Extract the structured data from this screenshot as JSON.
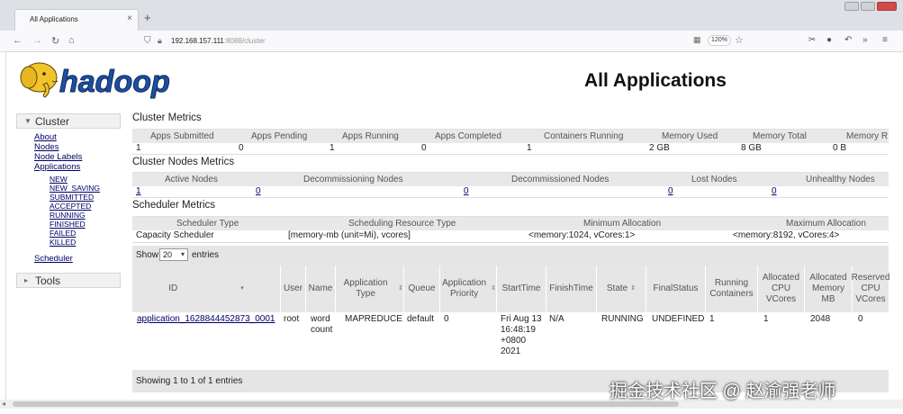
{
  "browser": {
    "tab_title": "All Applications",
    "tab_close": "×",
    "new_tab": "+",
    "url_host": "192.168.157.111",
    "url_path": ":8088/cluster",
    "zoom": "120%",
    "icons": [
      "back-icon",
      "forward-icon",
      "reload-icon",
      "home-icon",
      "shield-icon",
      "lock-icon",
      "reader-icon",
      "bookmark-star-icon",
      "extension-icon",
      "chat-icon",
      "undo-icon",
      "overflow-icon",
      "menu-icon"
    ]
  },
  "page": {
    "title": "All Applications",
    "logo_text": "hadoop"
  },
  "sidebar": {
    "cluster_label": "Cluster",
    "links": [
      "About",
      "Nodes",
      "Node Labels",
      "Applications"
    ],
    "app_states": [
      "NEW",
      "NEW_SAVING",
      "SUBMITTED",
      "ACCEPTED",
      "RUNNING",
      "FINISHED",
      "FAILED",
      "KILLED"
    ],
    "scheduler": "Scheduler",
    "tools_label": "Tools"
  },
  "cluster_metrics": {
    "title": "Cluster Metrics",
    "headers": [
      "Apps Submitted",
      "Apps Pending",
      "Apps Running",
      "Apps Completed",
      "Containers Running",
      "Memory Used",
      "Memory Total",
      "Memory R"
    ],
    "values": [
      "1",
      "0",
      "1",
      "0",
      "1",
      "2 GB",
      "8 GB",
      "0 B"
    ]
  },
  "node_metrics": {
    "title": "Cluster Nodes Metrics",
    "headers": [
      "Active Nodes",
      "Decommissioning Nodes",
      "Decommissioned Nodes",
      "Lost Nodes",
      "Unhealthy Nodes"
    ],
    "values": [
      "1",
      "0",
      "0",
      "0",
      "0"
    ]
  },
  "scheduler_metrics": {
    "title": "Scheduler Metrics",
    "headers": [
      "Scheduler Type",
      "Scheduling Resource Type",
      "Minimum Allocation",
      "Maximum Allocation"
    ],
    "values": [
      "Capacity Scheduler",
      "[memory-mb (unit=Mi), vcores]",
      "<memory:1024, vCores:1>",
      "<memory:8192, vCores:4>"
    ]
  },
  "entries": {
    "show": "Show",
    "count": "20",
    "suffix": "entries"
  },
  "apps_table": {
    "columns": [
      "ID",
      "User",
      "Name",
      "Application Type",
      "Queue",
      "Application Priority",
      "StartTime",
      "FinishTime",
      "State",
      "FinalStatus",
      "Running Containers",
      "Allocated CPU VCores",
      "Allocated Memory MB",
      "Reserved CPU VCores"
    ],
    "row": {
      "id": "application_1628844452873_0001",
      "user": "root",
      "name": "word count",
      "type": "MAPREDUCE",
      "queue": "default",
      "priority": "0",
      "start_time": "Fri Aug 13 16:48:19 +0800 2021",
      "finish_time": "N/A",
      "state": "RUNNING",
      "final_status": "UNDEFINED",
      "running_containers": "1",
      "alloc_vcores": "1",
      "alloc_memory": "2048",
      "reserved_vcores": "0"
    },
    "footer": "Showing 1 to 1 of 1 entries"
  },
  "watermark": "掘金技术社区 @ 赵渝强老师"
}
